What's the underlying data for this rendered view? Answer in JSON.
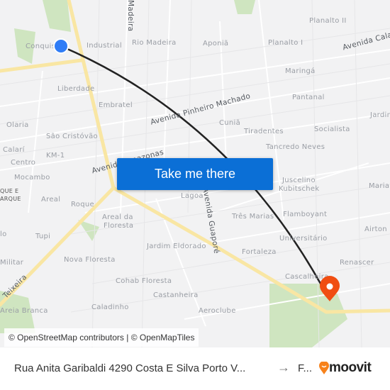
{
  "map": {
    "labels": [
      "Conquista",
      "Industrial",
      "Rio Madeira",
      "Aponiã",
      "Planalto I",
      "Planalto II",
      "Maringá",
      "Pantanal",
      "Liberdade",
      "Embratel",
      "Olaria",
      "São Cristóvão",
      "Calarí",
      "KM-1",
      "Centro",
      "Mocambo",
      "Areal",
      "Roque",
      "Cuniã",
      "Tiradentes",
      "Socialista",
      "Tancredo Neves",
      "Jardim",
      "Juscelino",
      "Kubitschek",
      "Maria",
      "Lagoa",
      "Três Marias",
      "Flamboyant",
      "Universitário",
      "Airton",
      "Fortaleza",
      "Renascer",
      "Cascalheira",
      "Areal da",
      "Floresta",
      "Tupi",
      "Jardim Eldorado",
      "Nova Floresta",
      "Militar",
      "Cohab Floresta",
      "Castanheira",
      "Caladinho",
      "Aeroclube",
      "Areia Branca",
      "QUE E",
      "ARQUE",
      "lo"
    ],
    "roads": [
      "Madeira",
      "Avenida Calama",
      "Avenida Pinheiro Machado",
      "Avenida Amazonas",
      "Avenida Guaporé",
      "Teixeira"
    ],
    "origin_color": "#2f7cf6",
    "destination_color": "#f04e12",
    "route_color": "#222222",
    "origin_icon": "origin-dot-icon",
    "destination_icon": "map-pin-icon"
  },
  "cta": {
    "label": "Take me there"
  },
  "attribution": "© OpenStreetMap contributors | © OpenMapTiles",
  "footer": {
    "from": "Rua Anita Garibaldi 4290 Costa E Silva Porto V...",
    "arrow": "→",
    "to": "F...",
    "brand": "moovit",
    "brand_color": "#f7821b"
  }
}
